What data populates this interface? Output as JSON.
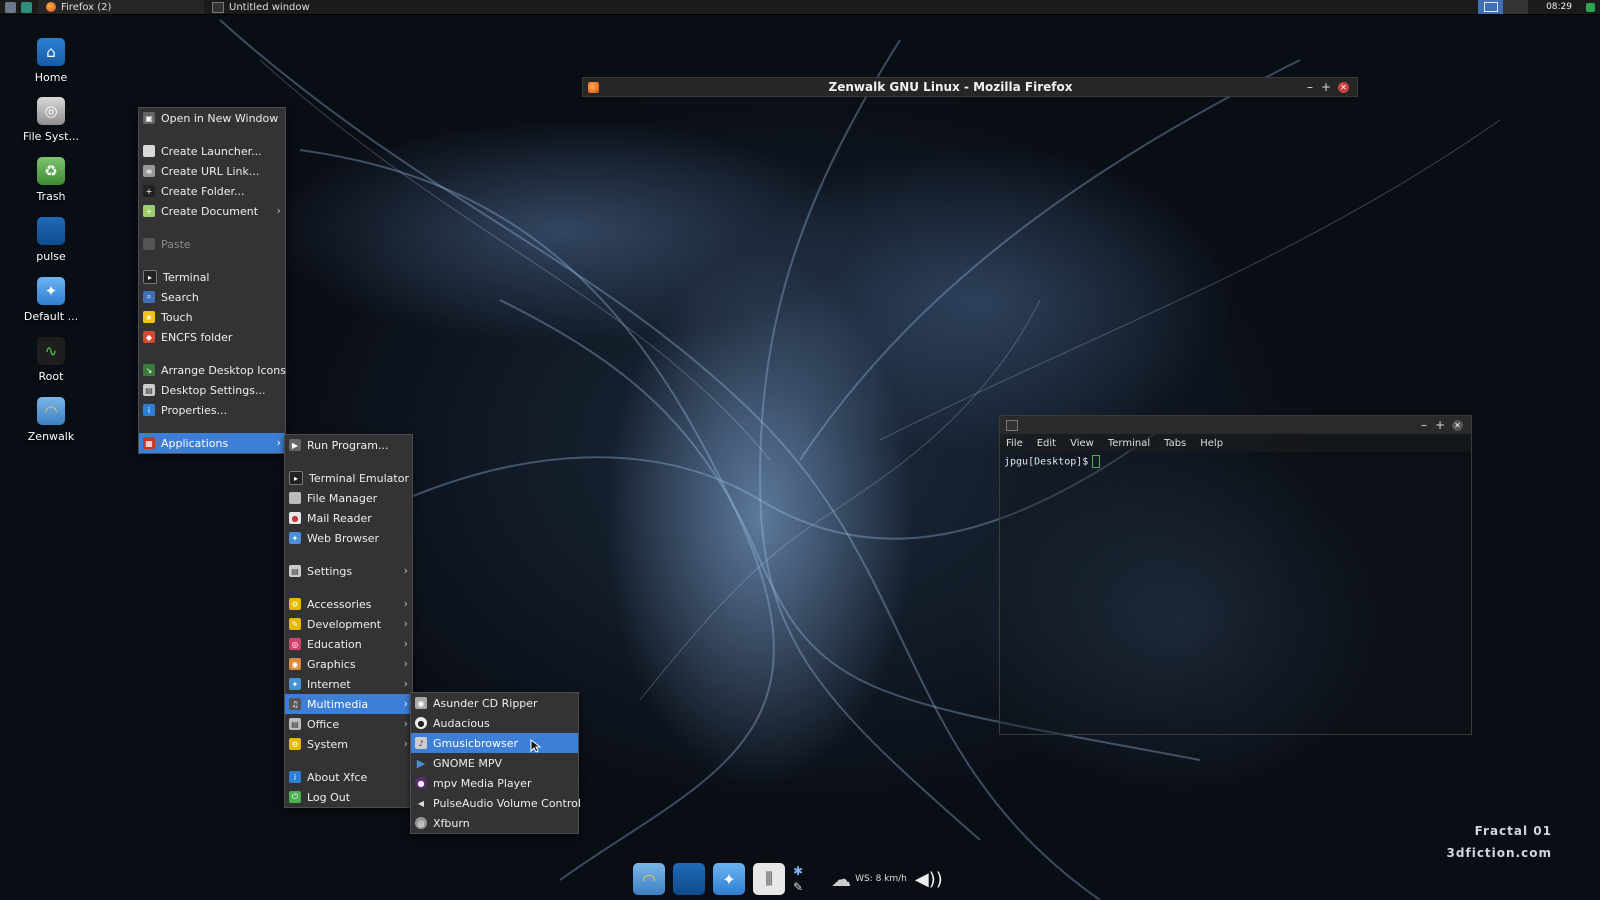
{
  "top_panel": {
    "tasks": [
      "Firefox (2)",
      "Untitled window"
    ],
    "clock": "08:29"
  },
  "desktop_icons": [
    "Home",
    "File Syst...",
    "Trash",
    "pulse",
    "Default ...",
    "Root",
    "Zenwalk"
  ],
  "desktop_menu": {
    "items": [
      {
        "label": "Open in New Window",
        "icon": "window-icon"
      },
      {
        "label": "Create Launcher...",
        "icon": "launcher-icon"
      },
      {
        "label": "Create URL Link...",
        "icon": "link-icon"
      },
      {
        "label": "Create Folder...",
        "icon": "folder-add-icon"
      },
      {
        "label": "Create Document",
        "icon": "document-icon",
        "submenu": true
      },
      {
        "label": "Paste",
        "icon": "paste-icon",
        "disabled": true
      },
      {
        "label": "Terminal",
        "icon": "terminal-icon"
      },
      {
        "label": "Search",
        "icon": "search-icon"
      },
      {
        "label": "Touch",
        "icon": "star-icon"
      },
      {
        "label": "ENCFS folder",
        "icon": "shield-icon"
      },
      {
        "label": "Arrange Desktop Icons",
        "icon": "arrange-icon"
      },
      {
        "label": "Desktop Settings...",
        "icon": "settings-icon"
      },
      {
        "label": "Properties...",
        "icon": "info-icon"
      },
      {
        "label": "Applications",
        "icon": "applications-icon",
        "submenu": true,
        "highlighted": true
      }
    ]
  },
  "applications_menu": {
    "items": [
      {
        "label": "Run Program...",
        "icon": "run-icon"
      },
      {
        "label": "Terminal Emulator",
        "icon": "terminal-icon"
      },
      {
        "label": "File Manager",
        "icon": "file-manager-icon"
      },
      {
        "label": "Mail Reader",
        "icon": "mail-icon"
      },
      {
        "label": "Web Browser",
        "icon": "globe-icon"
      },
      {
        "label": "Settings",
        "icon": "settings-icon",
        "submenu": true
      },
      {
        "label": "Accessories",
        "icon": "accessories-icon",
        "submenu": true
      },
      {
        "label": "Development",
        "icon": "development-icon",
        "submenu": true
      },
      {
        "label": "Education",
        "icon": "education-icon",
        "submenu": true
      },
      {
        "label": "Graphics",
        "icon": "graphics-icon",
        "submenu": true
      },
      {
        "label": "Internet",
        "icon": "internet-icon",
        "submenu": true
      },
      {
        "label": "Multimedia",
        "icon": "multimedia-icon",
        "submenu": true,
        "highlighted": true
      },
      {
        "label": "Office",
        "icon": "office-icon",
        "submenu": true
      },
      {
        "label": "System",
        "icon": "system-icon",
        "submenu": true
      },
      {
        "label": "About Xfce",
        "icon": "info-icon"
      },
      {
        "label": "Log Out",
        "icon": "logout-icon"
      }
    ]
  },
  "multimedia_menu": {
    "items": [
      {
        "label": "Asunder CD Ripper",
        "icon": "cd-icon"
      },
      {
        "label": "Audacious",
        "icon": "audacious-icon"
      },
      {
        "label": "Gmusicbrowser",
        "icon": "music-icon",
        "highlighted": true
      },
      {
        "label": "GNOME MPV",
        "icon": "play-icon"
      },
      {
        "label": "mpv Media Player",
        "icon": "mpv-icon"
      },
      {
        "label": "PulseAudio Volume Control",
        "icon": "volume-icon"
      },
      {
        "label": "Xfburn",
        "icon": "burn-icon"
      }
    ]
  },
  "firefox_window": {
    "title": "Zenwalk GNU Linux - Mozilla Firefox"
  },
  "terminal": {
    "menu": [
      "File",
      "Edit",
      "View",
      "Terminal",
      "Tabs",
      "Help"
    ],
    "prompt": "jpgu[Desktop]$"
  },
  "dock": {
    "weather": "WS: 8 km/h"
  },
  "watermark": {
    "line1": "Fractal 01",
    "line2": "3dfiction.com"
  },
  "colors": {
    "highlight": "#3d7fd6",
    "menu_bg": "#333335",
    "close": "#c94040"
  }
}
